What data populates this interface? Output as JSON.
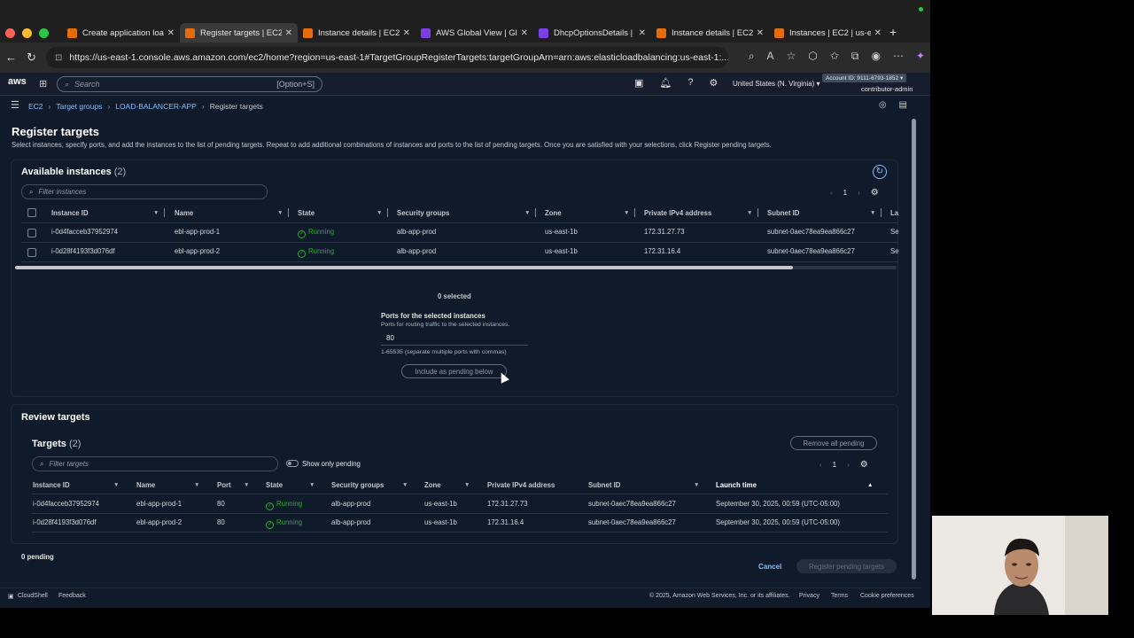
{
  "browser": {
    "tabs": [
      {
        "label": "Create application loa",
        "active": false,
        "color": "#e46c0a"
      },
      {
        "label": "Register targets | EC2",
        "active": true,
        "color": "#e46c0a"
      },
      {
        "label": "Instance details | EC2",
        "active": false,
        "color": "#e46c0a"
      },
      {
        "label": "AWS Global View | Glo",
        "active": false,
        "color": "#7b3fe4"
      },
      {
        "label": "DhcpOptionsDetails | V",
        "active": false,
        "color": "#7b3fe4"
      },
      {
        "label": "Instance details | EC2",
        "active": false,
        "color": "#e46c0a"
      },
      {
        "label": "Instances | EC2 | us-e",
        "active": false,
        "color": "#e46c0a"
      }
    ],
    "url": "https://us-east-1.console.aws.amazon.com/ec2/home?region=us-east-1#TargetGroupRegisterTargets:targetGroupArn=arn:aws:elasticloadbalancing:us-east-1:..."
  },
  "console": {
    "logo": "aws",
    "search_placeholder": "Search",
    "search_shortcut": "[Option+S]",
    "region": "United States (N. Virginia) ▾",
    "account": "Account ID: 9111-6793-1852 ▾",
    "role": "contributor-admin"
  },
  "breadcrumb": [
    "EC2",
    "Target groups",
    "LOAD-BALANCER-APP",
    "Register targets"
  ],
  "page": {
    "title": "Register targets",
    "description": "Select instances, specify ports, and add the instances to the list of pending targets. Repeat to add additional combinations of instances and ports to the list of pending targets. Once you are satisfied with your selections, click Register pending targets."
  },
  "available": {
    "title": "Available instances",
    "count": "(2)",
    "filter_placeholder": "Filter instances",
    "page": "1",
    "columns": [
      "Instance ID",
      "Name",
      "State",
      "Security groups",
      "Zone",
      "Private IPv4 address",
      "Subnet ID",
      "La"
    ],
    "rows": [
      {
        "id": "i-0d4facceb37952974",
        "name": "ebl-app-prod-1",
        "state": "Running",
        "sg": "alb-app-prod",
        "zone": "us-east-1b",
        "ip": "172.31.27.73",
        "subnet": "subnet-0aec78ea9ea866c27",
        "extra": "Se"
      },
      {
        "id": "i-0d28f4193f3d076df",
        "name": "ebl-app-prod-2",
        "state": "Running",
        "sg": "alb-app-prod",
        "zone": "us-east-1b",
        "ip": "172.31.16.4",
        "subnet": "subnet-0aec78ea9ea866c27",
        "extra": "Se"
      }
    ],
    "selected": "0 selected",
    "ports_label": "Ports for the selected instances",
    "ports_hint": "Ports for routing traffic to the selected instances.",
    "port_value": "80",
    "ports_constraint": "1-65535 (separate multiple ports with commas)",
    "include_button": "Include as pending below"
  },
  "review": {
    "title": "Review targets",
    "targets_title": "Targets",
    "count": "(2)",
    "remove_all": "Remove all pending",
    "filter_placeholder": "Filter targets",
    "show_pending": "Show only pending",
    "page": "1",
    "columns": [
      "Instance ID",
      "Name",
      "Port",
      "State",
      "Security groups",
      "Zone",
      "Private IPv4 address",
      "Subnet ID",
      "Launch time"
    ],
    "rows": [
      {
        "id": "i-0d4facceb37952974",
        "name": "ebl-app-prod-1",
        "port": "80",
        "state": "Running",
        "sg": "alb-app-prod",
        "zone": "us-east-1b",
        "ip": "172.31.27.73",
        "subnet": "subnet-0aec78ea9ea866c27",
        "launch": "September 30, 2025, 00:59 (UTC-05:00)"
      },
      {
        "id": "i-0d28f4193f3d076df",
        "name": "ebl-app-prod-2",
        "port": "80",
        "state": "Running",
        "sg": "alb-app-prod",
        "zone": "us-east-1b",
        "ip": "172.31.16.4",
        "subnet": "subnet-0aec78ea9ea866c27",
        "launch": "September 30, 2025, 00:59 (UTC-05:00)"
      }
    ],
    "pending": "0 pending",
    "cancel": "Cancel",
    "register": "Register pending targets"
  },
  "footer": {
    "cloudshell": "CloudShell",
    "feedback": "Feedback",
    "copyright": "© 2025, Amazon Web Services, Inc. or its affiliates.",
    "privacy": "Privacy",
    "terms": "Terms",
    "cookies": "Cookie preferences"
  }
}
